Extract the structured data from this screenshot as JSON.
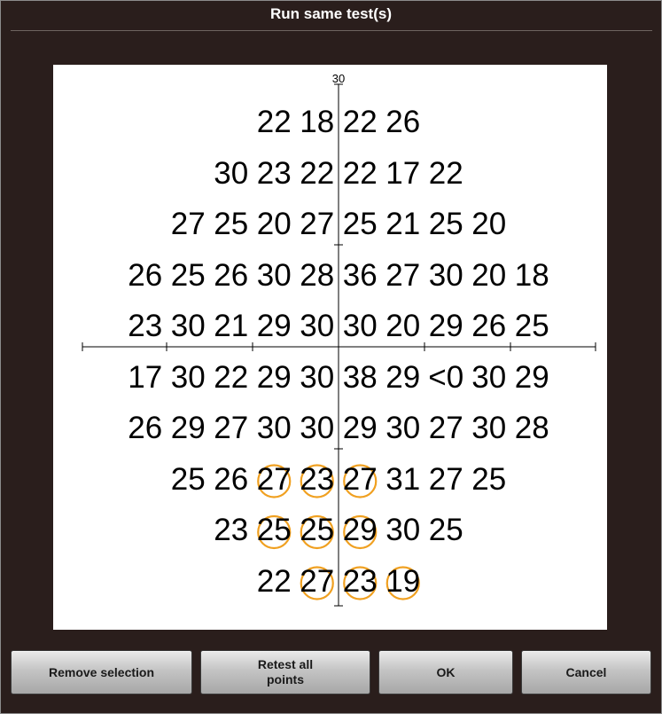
{
  "dialog": {
    "title": "Run same test(s)"
  },
  "field": {
    "axis_label": "30",
    "grid": [
      [
        "22",
        "18",
        "22",
        "26"
      ],
      [
        "30",
        "23",
        "22",
        "22",
        "17",
        "22"
      ],
      [
        "27",
        "25",
        "20",
        "27",
        "25",
        "21",
        "25",
        "20"
      ],
      [
        "26",
        "25",
        "26",
        "30",
        "28",
        "36",
        "27",
        "30",
        "20",
        "18"
      ],
      [
        "23",
        "30",
        "21",
        "29",
        "30",
        "30",
        "20",
        "29",
        "26",
        "25"
      ],
      [
        "17",
        "30",
        "22",
        "29",
        "30",
        "38",
        "29",
        "<0",
        "30",
        "29"
      ],
      [
        "26",
        "29",
        "27",
        "30",
        "30",
        "29",
        "30",
        "27",
        "30",
        "28"
      ],
      [
        "25",
        "26",
        "27",
        "23",
        "27",
        "31",
        "27",
        "25"
      ],
      [
        "23",
        "25",
        "25",
        "29",
        "30",
        "25"
      ],
      [
        "22",
        "27",
        "23",
        "19"
      ]
    ],
    "selected_marker_color": "#f0a020",
    "selected_points": [
      "row8-col3",
      "row8-col4",
      "row8-col5",
      "row9-col2",
      "row9-col3",
      "row9-col4",
      "row10-col2",
      "row10-col3",
      "row10-col4"
    ]
  },
  "buttons": {
    "remove_selection": "Remove selection",
    "retest_all_line1": "Retest all",
    "retest_all_line2": "points",
    "ok": "OK",
    "cancel": "Cancel"
  },
  "colors": {
    "background": "#2a1e1c",
    "field_background": "#ffffff",
    "title_text": "#ffffff"
  }
}
